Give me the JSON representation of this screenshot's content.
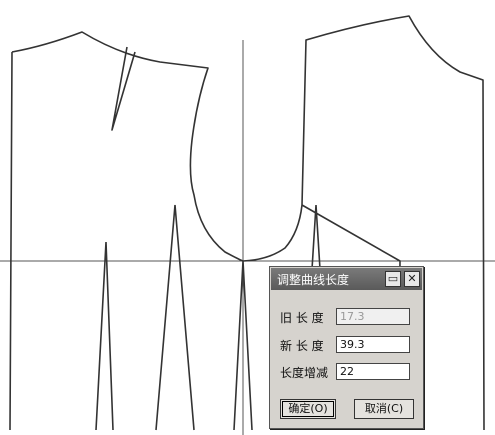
{
  "dialog": {
    "title": "调整曲线长度",
    "minimize_glyph": "▭",
    "close_glyph": "✕",
    "fields": [
      {
        "label": "旧 长 度",
        "value": "17.3",
        "readonly": true
      },
      {
        "label": "新 长 度",
        "value": "39.3",
        "readonly": false
      },
      {
        "label": "长度增减",
        "value": "22",
        "readonly": false
      }
    ],
    "ok_label": "确定(O)",
    "cancel_label": "取消(C)"
  }
}
